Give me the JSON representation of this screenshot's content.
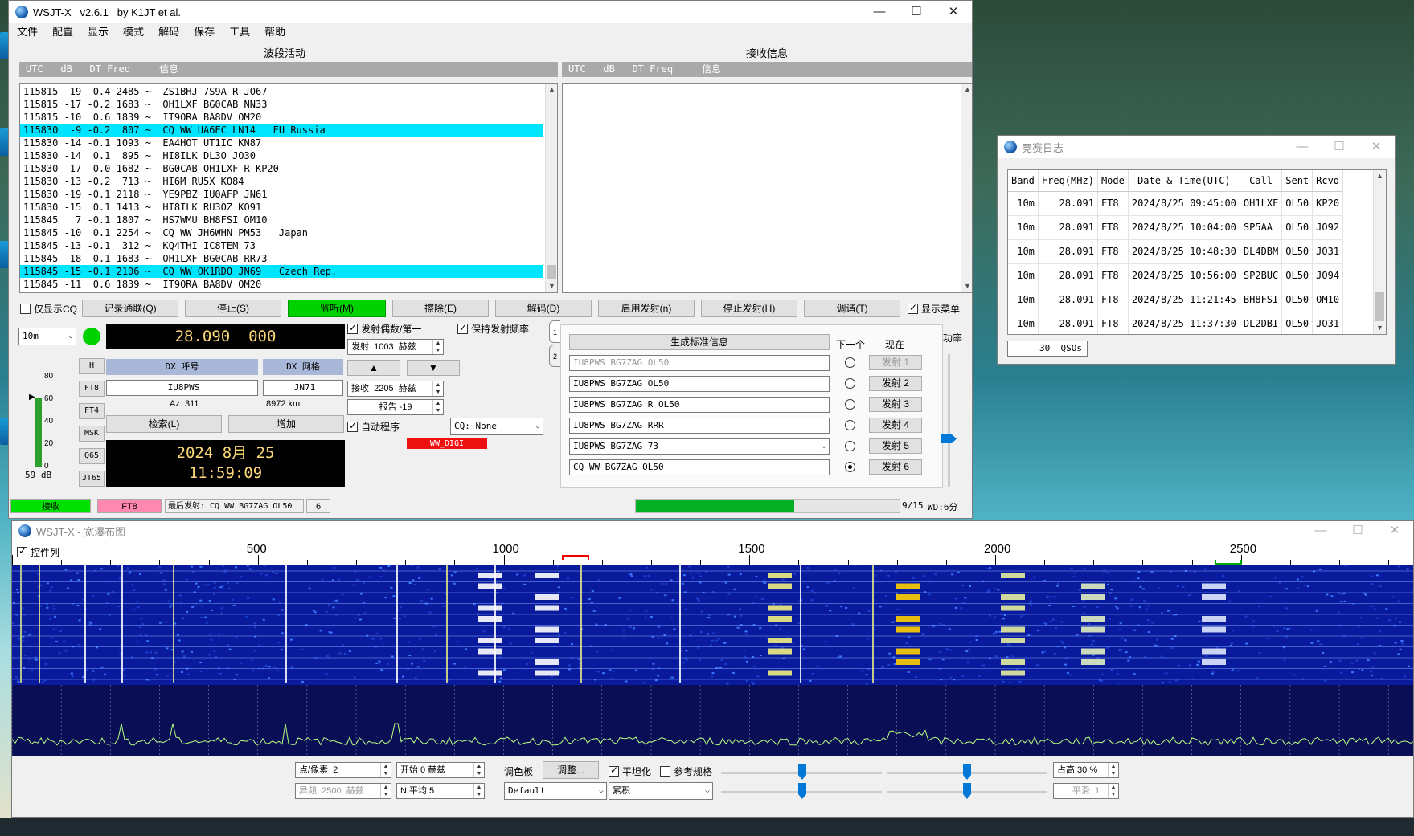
{
  "main_window": {
    "title": "WSJT-X   v2.6.1   by K1JT et al.",
    "menu": [
      "文件",
      "配置",
      "显示",
      "模式",
      "解码",
      "保存",
      "工具",
      "帮助"
    ],
    "band_activity_title": "波段活动",
    "rx_freq_title": "接收信息",
    "band_activity_header": "UTC   dB   DT Freq     信息",
    "rx_freq_header": "UTC   dB   DT Freq     信息",
    "decodes": [
      {
        "text": "115815 -19 -0.4 2485 ~  ZS1BHJ 7S9A R JO67",
        "highlight": false
      },
      {
        "text": "115815 -17 -0.2 1683 ~  OH1LXF BG0CAB NN33",
        "highlight": false
      },
      {
        "text": "115815 -10  0.6 1839 ~  IT9ORA BA8DV OM20",
        "highlight": false
      },
      {
        "text": "115830  -9 -0.2  807 ~  CQ WW UA6EC LN14   EU Russia",
        "highlight": true
      },
      {
        "text": "115830 -14 -0.1 1093 ~  EA4HOT UT1IC KN87",
        "highlight": false
      },
      {
        "text": "115830 -14  0.1  895 ~  HI8ILK DL3O JO30",
        "highlight": false
      },
      {
        "text": "115830 -17 -0.0 1682 ~  BG0CAB OH1LXF R KP20",
        "highlight": false
      },
      {
        "text": "115830 -13 -0.2  713 ~  HI6M RU5X KO84",
        "highlight": false
      },
      {
        "text": "115830 -19 -0.1 2118 ~  YE9PBZ IU0AFP JN61",
        "highlight": false
      },
      {
        "text": "115830 -15  0.1 1413 ~  HI8ILK RU3OZ KO91",
        "highlight": false
      },
      {
        "text": "115845   7 -0.1 1807 ~  HS7WMU BH8FSI OM10",
        "highlight": false
      },
      {
        "text": "115845 -10  0.1 2254 ~  CQ WW JH6WHN PM53   Japan",
        "highlight": false
      },
      {
        "text": "115845 -13 -0.1  312 ~  KQ4THI IC8TEM 73",
        "highlight": false
      },
      {
        "text": "115845 -18 -0.1 1683 ~  OH1LXF BG0CAB RR73",
        "highlight": false
      },
      {
        "text": "115845 -15 -0.1 2106 ~  CQ WW OK1RDO JN69   Czech Rep.",
        "highlight": true
      },
      {
        "text": "115845 -11  0.6 1839 ~  IT9ORA BA8DV OM20",
        "highlight": false
      }
    ],
    "buttons": {
      "cq_only": "仅显示CQ",
      "log_qso": "记录通联(Q)",
      "stop": "停止(S)",
      "monitor": "监听(M)",
      "erase": "擦除(E)",
      "decode": "解码(D)",
      "enable_tx": "启用发射(n)",
      "halt_tx": "停止发射(H)",
      "tune": "调谐(T)",
      "show_menu": "显示菜单"
    },
    "band": "10m",
    "dial_freq": "28.090  000",
    "dx_call_label": "DX 呼号",
    "dx_grid_label": "DX 网格",
    "dx_call": "IU8PWS",
    "dx_grid": "JN71",
    "az": "Az: 311",
    "dist": "8972 km",
    "lookup": "检索(L)",
    "add": "增加",
    "date": "2024 8月 25",
    "time": "11:59:09",
    "modes": [
      "H",
      "FT8",
      "FT4",
      "MSK",
      "Q65",
      "JT65"
    ],
    "meter_ticks": [
      "80",
      "60",
      "40",
      "20",
      "0"
    ],
    "meter_db": "59 dB",
    "tx_even_first": "发射偶数/第一",
    "hold_tx_freq": "保持发射频率",
    "tx_freq": "发射  1003  赫兹",
    "rx_freq": "接收  2205  赫兹",
    "report": "报告 -19",
    "auto_seq": "自动程序",
    "cq_select": "CQ: None",
    "ww_digi": "WW_DIGI",
    "gen_std_msgs": "生成标准信息",
    "next_label": "下一个",
    "now_label": "现在",
    "power_label": "功率",
    "tab1": "1",
    "tab2": "2",
    "tx_msgs": [
      {
        "msg": "IU8PWS BG7ZAG OL50",
        "btn": "发射 1",
        "selected": false,
        "dim": true
      },
      {
        "msg": "IU8PWS BG7ZAG OL50",
        "btn": "发射 2",
        "selected": false,
        "dim": false
      },
      {
        "msg": "IU8PWS BG7ZAG R OL50",
        "btn": "发射 3",
        "selected": false,
        "dim": false
      },
      {
        "msg": "IU8PWS BG7ZAG RRR",
        "btn": "发射 4",
        "selected": false,
        "dim": false
      },
      {
        "msg": "IU8PWS BG7ZAG 73",
        "btn": "发射 5",
        "selected": false,
        "dim": false
      },
      {
        "msg": "CQ WW BG7ZAG OL50",
        "btn": "发射 6",
        "selected": true,
        "dim": false
      }
    ],
    "status": {
      "state": "接收",
      "mode": "FT8",
      "last_tx": "最后发射: CQ WW BG7ZAG OL50",
      "count": "6",
      "progress_text": "9/15",
      "progress": 0.6,
      "wd": "WD:6分"
    }
  },
  "contest_log": {
    "title": "竞赛日志",
    "columns": [
      "Band",
      "Freq(MHz)",
      "Mode",
      "Date & Time(UTC)",
      "Call",
      "Sent",
      "Rcvd"
    ],
    "rows": [
      [
        "10m",
        "28.091",
        "FT8",
        "2024/8/25 09:45:00",
        "OH1LXF",
        "OL50",
        "KP20"
      ],
      [
        "10m",
        "28.091",
        "FT8",
        "2024/8/25 10:04:00",
        "SP5AA",
        "OL50",
        "JO92"
      ],
      [
        "10m",
        "28.091",
        "FT8",
        "2024/8/25 10:48:30",
        "DL4DBM",
        "OL50",
        "JO31"
      ],
      [
        "10m",
        "28.091",
        "FT8",
        "2024/8/25 10:56:00",
        "SP2BUC",
        "OL50",
        "JO94"
      ],
      [
        "10m",
        "28.091",
        "FT8",
        "2024/8/25 11:21:45",
        "BH8FSI",
        "OL50",
        "OM10"
      ],
      [
        "10m",
        "28.091",
        "FT8",
        "2024/8/25 11:37:30",
        "DL2DBI",
        "OL50",
        "JO31"
      ]
    ],
    "qso_count": "30  QSOs"
  },
  "waterfall": {
    "title": "WSJT-X - 宽瀑布图",
    "controls_label": "控件列",
    "freq_ticks": [
      "500",
      "1000",
      "1500",
      "2000",
      "2500"
    ],
    "bins_per_pixel": "点/像素  2",
    "start": "开始 0 赫兹",
    "palette": "调色板",
    "adjust": "调整...",
    "flatten": "平坦化",
    "ref_spec": "参考规格",
    "zero_pct": "占高 30 %",
    "split": "异频  2500  赫兹",
    "n_avg": "N 平均 5",
    "palette_name": "Default",
    "spectrum_type": "累积",
    "smooth": "平滑  1"
  },
  "colors": {
    "highlight": "#00e5ff",
    "monitor_green": "#00d200",
    "rx_status": "#00e000",
    "mode_status": "#ff88b0",
    "ww_digi": "#ee1111",
    "lbtn": "#a9b8d8"
  }
}
